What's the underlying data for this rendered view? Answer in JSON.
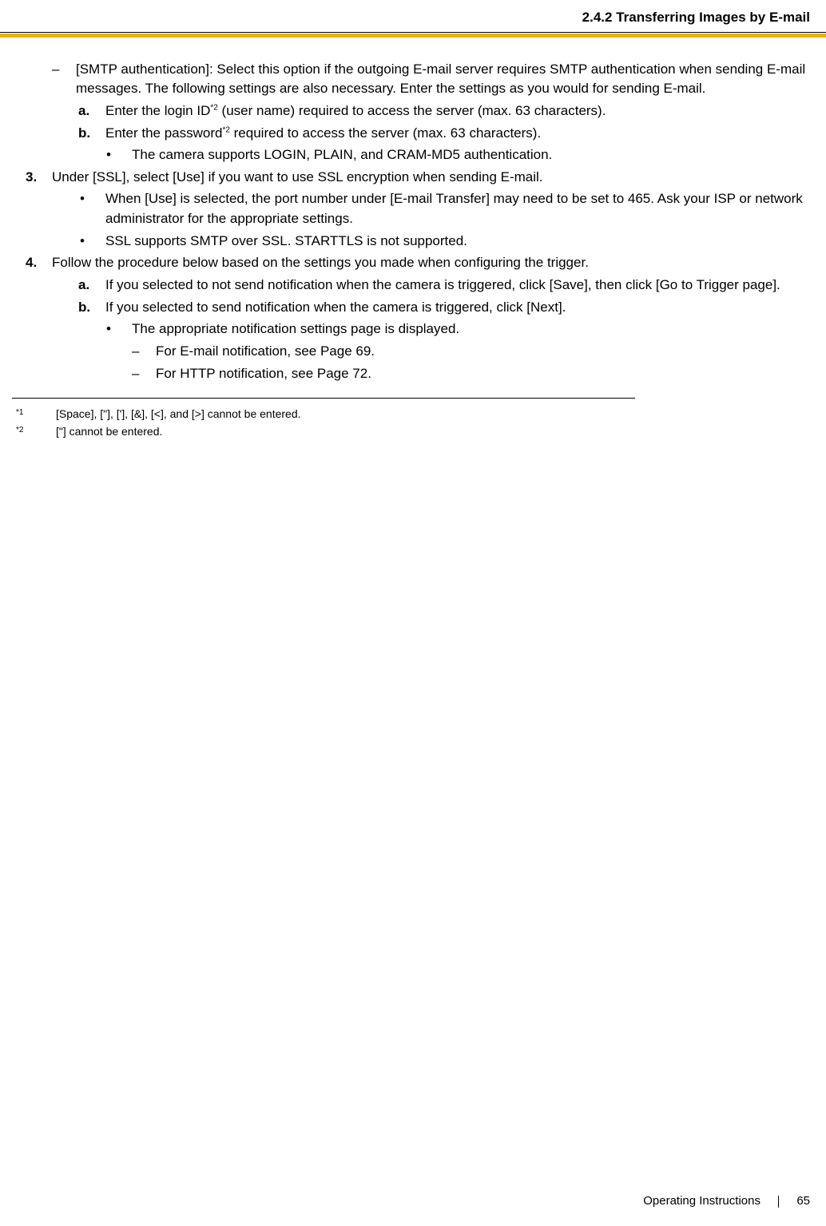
{
  "header": {
    "section_title": "2.4.2 Transferring Images by E-mail"
  },
  "body": {
    "smtp_dash": "[SMTP authentication]: Select this option if the outgoing E-mail server requires SMTP authentication when sending E-mail messages. The following settings are also necessary. Enter the settings as you would for sending E-mail.",
    "smtp_a_pre": "Enter the login ID",
    "smtp_a_post": " (user name) required to access the server (max. 63 characters).",
    "smtp_b_pre": "Enter the password",
    "smtp_b_post": " required to access the server (max. 63 characters).",
    "smtp_b_bullet": "The camera supports LOGIN, PLAIN, and CRAM-MD5 authentication.",
    "step3": "Under [SSL], select [Use] if you want to use SSL encryption when sending E-mail.",
    "step3_bullet1": "When [Use] is selected, the port number under [E-mail Transfer] may need to be set to 465. Ask your ISP or network administrator for the appropriate settings.",
    "step3_bullet2": "SSL supports SMTP over SSL. STARTTLS is not supported.",
    "step4": "Follow the procedure below based on the settings you made when configuring the trigger.",
    "step4_a": "If you selected to not send notification when the camera is triggered, click [Save], then click [Go to Trigger page].",
    "step4_b": "If you selected to send notification when the camera is triggered, click [Next].",
    "step4_b_bullet": "The appropriate notification settings page is displayed.",
    "step4_b_dash1": "For E-mail notification, see Page 69.",
    "step4_b_dash2": "For HTTP notification, see Page 72.",
    "markers": {
      "dash": "–",
      "a": "a.",
      "b": "b.",
      "bullet": "•",
      "n3": "3.",
      "n4": "4.",
      "star2": "*2"
    }
  },
  "footnotes": {
    "fn1_marker": "*1",
    "fn1_text": "[Space], [\"], ['], [&], [<], and [>] cannot be entered.",
    "fn2_marker": "*2",
    "fn2_text": "[\"] cannot be entered."
  },
  "footer": {
    "doc_title": "Operating Instructions",
    "page_number": "65"
  }
}
